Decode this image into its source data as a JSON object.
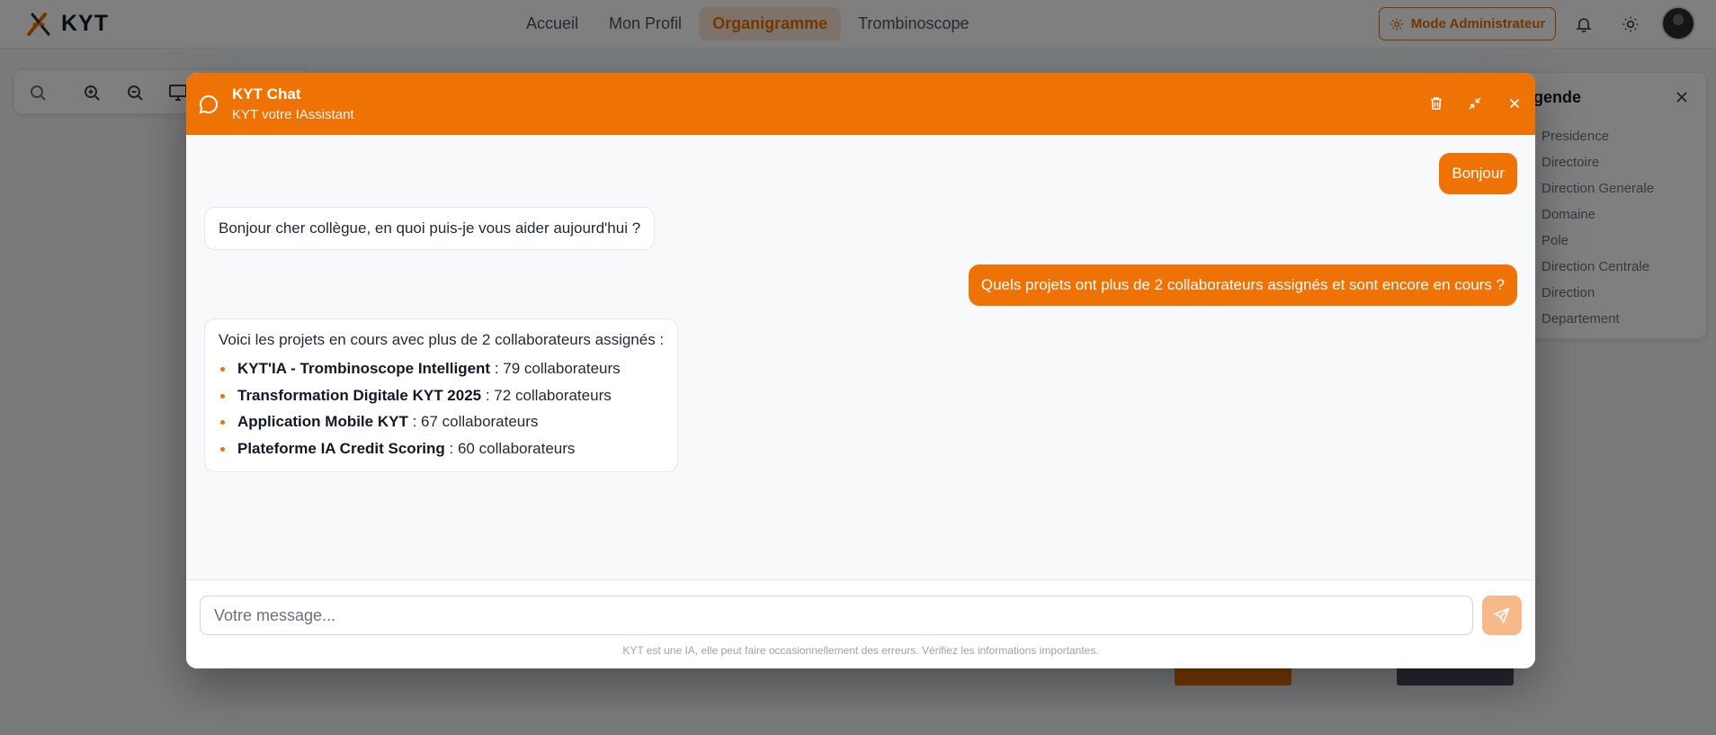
{
  "app": {
    "name": "KYT"
  },
  "nav": [
    {
      "label": "Accueil",
      "active": false
    },
    {
      "label": "Mon Profil",
      "active": false
    },
    {
      "label": "Organigramme",
      "active": true
    },
    {
      "label": "Trombinoscope",
      "active": false
    }
  ],
  "header": {
    "admin_label": "Mode Administrateur",
    "icons": [
      "settings-gear-icon",
      "bell-icon",
      "sun-icon"
    ]
  },
  "toolbar": {
    "icons": [
      "search-icon",
      "zoom-in-icon",
      "zoom-out-icon",
      "monitor-icon"
    ]
  },
  "legend": {
    "title": "Légende",
    "items": [
      "Presidence",
      "Directoire",
      "Direction Generale",
      "Domaine",
      "Pole",
      "Direction Centrale",
      "Direction",
      "Departement"
    ]
  },
  "chat": {
    "title": "KYT Chat",
    "subtitle": "KYT votre IAssistant",
    "header_icons": [
      "trash-icon",
      "minimize-icon",
      "close-icon"
    ],
    "messages": [
      {
        "role": "user",
        "text": "Bonjour"
      },
      {
        "role": "bot",
        "text": "Bonjour cher collègue, en quoi puis-je vous aider aujourd'hui ?"
      },
      {
        "role": "user",
        "text": "Quels projets ont plus de 2 collaborateurs assignés et sont encore en cours ?"
      },
      {
        "role": "bot",
        "intro": "Voici les projets en cours avec plus de 2 collaborateurs assignés :",
        "items": [
          {
            "name": "KYT'IA - Trombinoscope Intelligent",
            "detail": " : 79 collaborateurs"
          },
          {
            "name": "Transformation Digitale KYT 2025",
            "detail": " : 72 collaborateurs"
          },
          {
            "name": "Application Mobile KYT",
            "detail": " : 67 collaborateurs"
          },
          {
            "name": "Plateforme IA Credit Scoring",
            "detail": " : 60 collaborateurs"
          }
        ]
      }
    ],
    "input_placeholder": "Votre message...",
    "disclaimer": "KYT est une IA, elle peut faire occasionnellement des erreurs. Vérifiez les informations importantes."
  },
  "colors": {
    "accent": "#ef7205",
    "accent_light": "#f7b98a",
    "overlay": "rgba(0,0,0,0.5)"
  }
}
